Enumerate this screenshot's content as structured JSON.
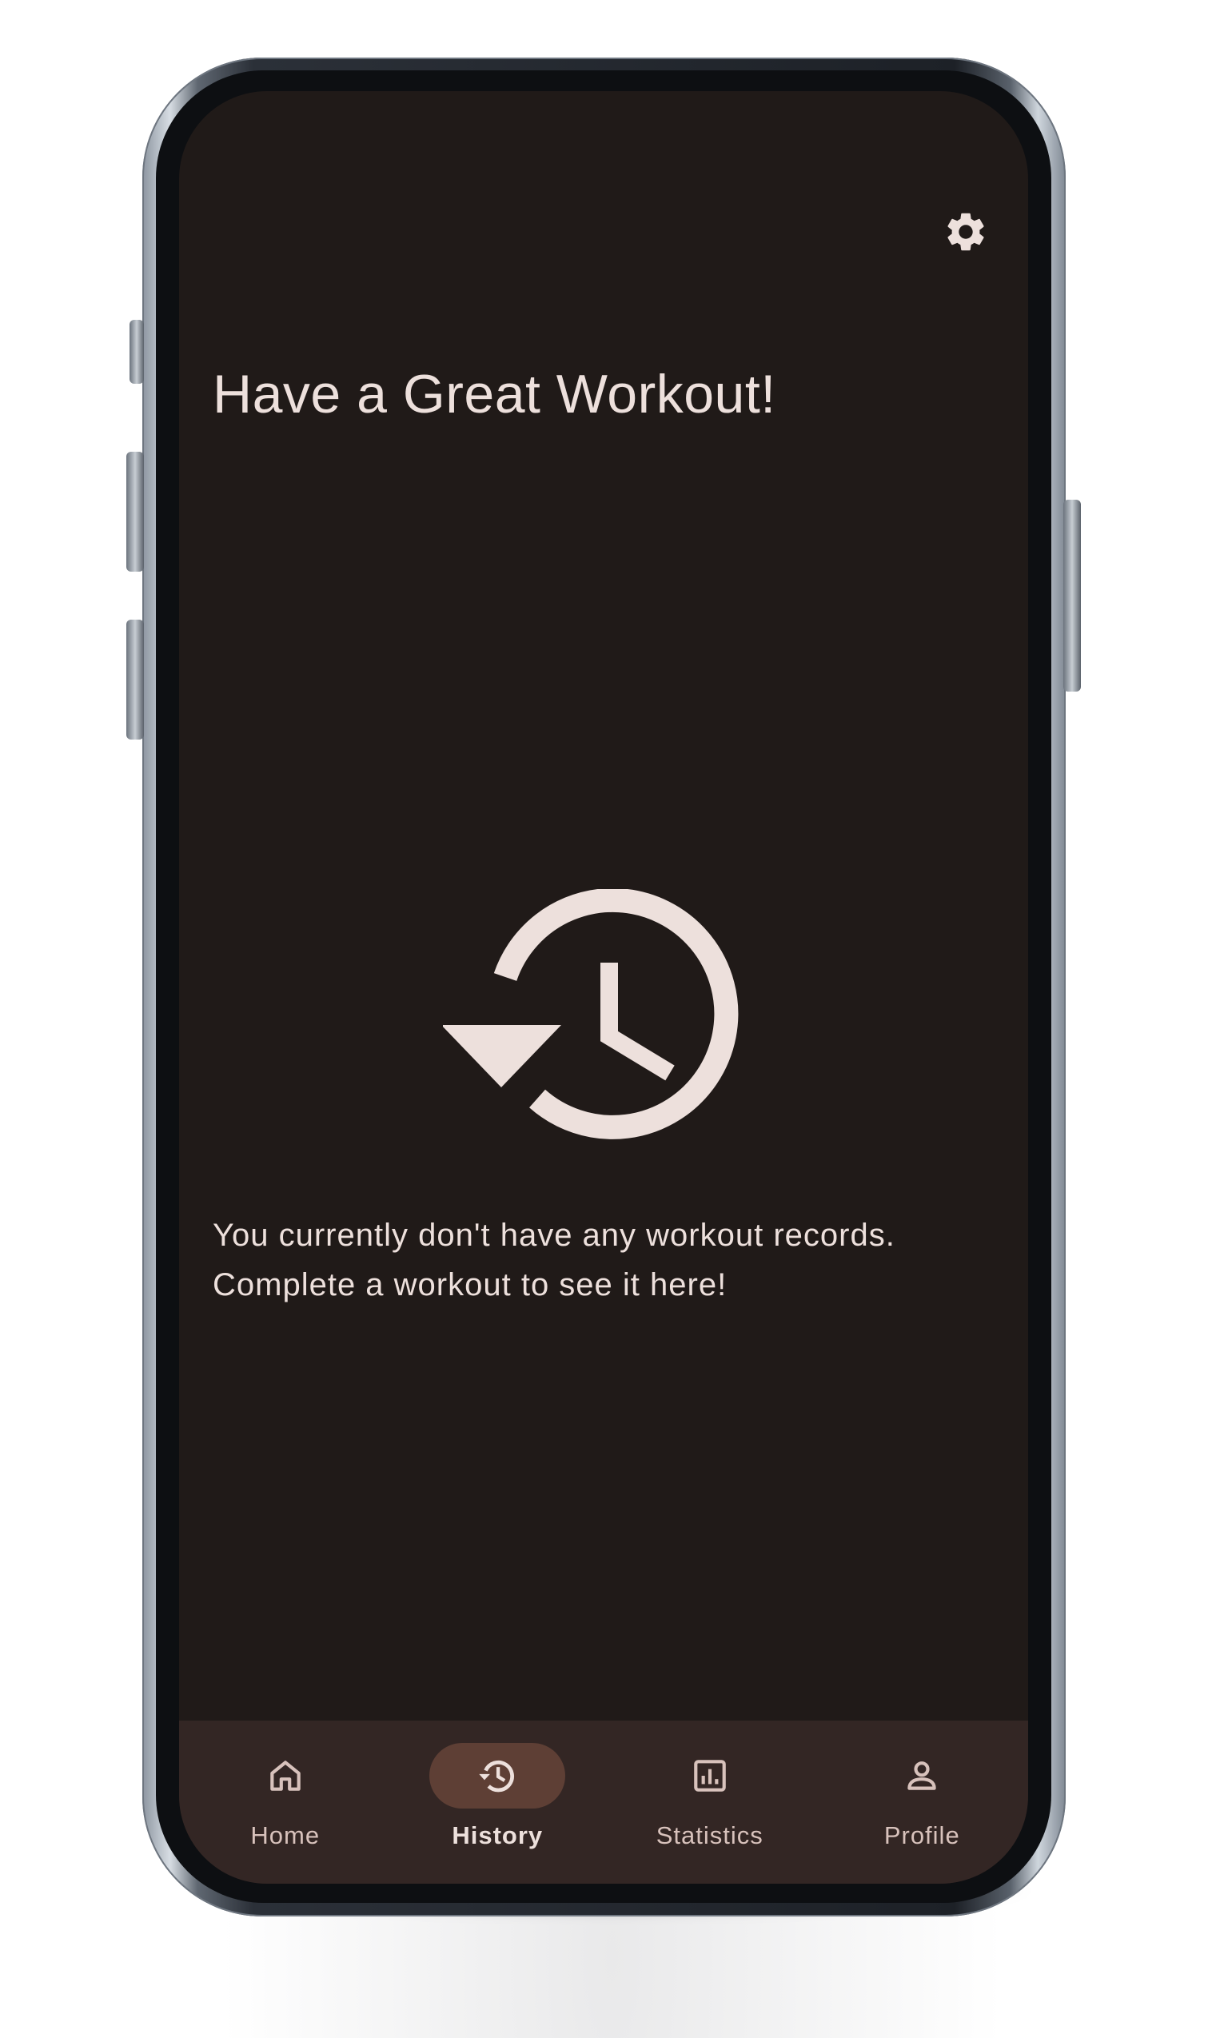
{
  "screen": {
    "title": "Have a Great Workout!",
    "empty_state": {
      "icon": "history-icon",
      "line1": "You currently don't have any workout records.",
      "line2": "Complete a workout to see it here!"
    },
    "settings_icon": "gear-icon"
  },
  "nav": {
    "items": [
      {
        "label": "Home",
        "icon": "home-icon",
        "active": false
      },
      {
        "label": "History",
        "icon": "history-icon",
        "active": true
      },
      {
        "label": "Statistics",
        "icon": "bar-chart-icon",
        "active": false
      },
      {
        "label": "Profile",
        "icon": "person-icon",
        "active": false
      }
    ]
  },
  "colors": {
    "background": "#201a18",
    "text": "#ede0dc",
    "navbar": "#332624",
    "active_pill": "#5e3f35",
    "inactive_label": "#d8c2bc"
  }
}
